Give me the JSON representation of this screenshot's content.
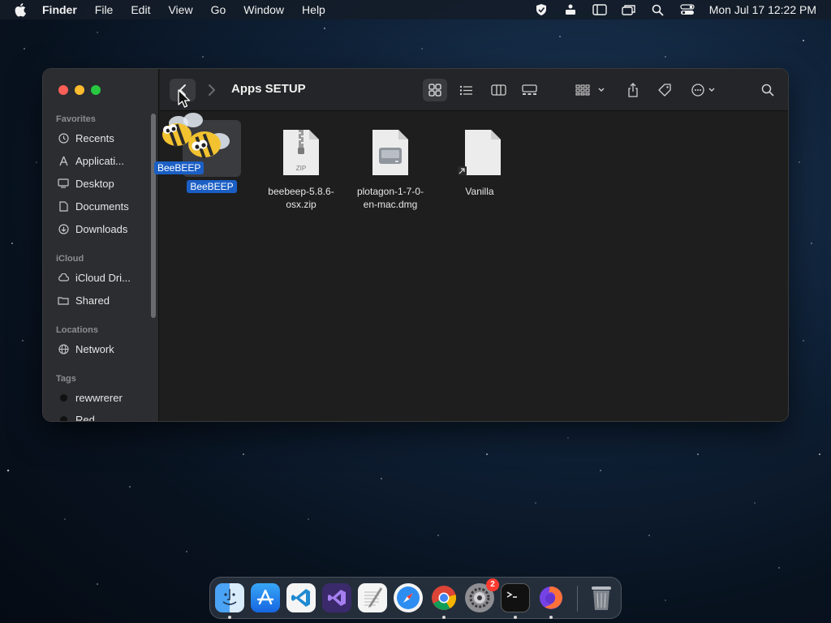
{
  "menubar": {
    "app_name": "Finder",
    "items": [
      "File",
      "Edit",
      "View",
      "Go",
      "Window",
      "Help"
    ],
    "clock": "Mon Jul 17  12:22 PM"
  },
  "window": {
    "title": "Apps SETUP",
    "sidebar": {
      "favorites_heading": "Favorites",
      "favorites": [
        {
          "label": "Recents",
          "icon": "clock-icon"
        },
        {
          "label": "Applicati...",
          "icon": "applications-icon"
        },
        {
          "label": "Desktop",
          "icon": "desktop-icon"
        },
        {
          "label": "Documents",
          "icon": "document-icon"
        },
        {
          "label": "Downloads",
          "icon": "download-icon"
        }
      ],
      "icloud_heading": "iCloud",
      "icloud": [
        {
          "label": "iCloud Dri...",
          "icon": "cloud-icon"
        },
        {
          "label": "Shared",
          "icon": "shared-folder-icon"
        }
      ],
      "locations_heading": "Locations",
      "locations": [
        {
          "label": "Network",
          "icon": "globe-icon"
        }
      ],
      "tags_heading": "Tags",
      "tags": [
        {
          "label": "rewwrerer",
          "color": "#1a1a1a"
        },
        {
          "label": "Red",
          "color": "#1a1a1a"
        }
      ]
    },
    "files": [
      {
        "name": "BeeBEEP",
        "selected": true,
        "icon": "bee-app-icon"
      },
      {
        "name_line1": "beebeep-5.8.6-",
        "name_line2": "osx.zip",
        "icon": "zip-file-icon",
        "badge": "ZIP"
      },
      {
        "name_line1": "plotagon-1-7-0-",
        "name_line2": "en-mac.dmg",
        "icon": "disk-image-icon"
      },
      {
        "name": "Vanilla",
        "icon": "alias-file-icon"
      }
    ],
    "drag_label": "BeeBEEP"
  },
  "dock": {
    "apps": [
      "finder-icon",
      "app-store-icon",
      "vscode-icon",
      "visual-studio-icon",
      "textedit-icon",
      "safari-icon",
      "chrome-icon",
      "system-settings-icon",
      "terminal-icon",
      "firefox-icon",
      "trash-icon"
    ],
    "settings_badge": "2"
  },
  "colors": {
    "accent": "#1b5fc5",
    "close": "#ff5f57",
    "minimize": "#febc2e",
    "maximize": "#28c840"
  }
}
